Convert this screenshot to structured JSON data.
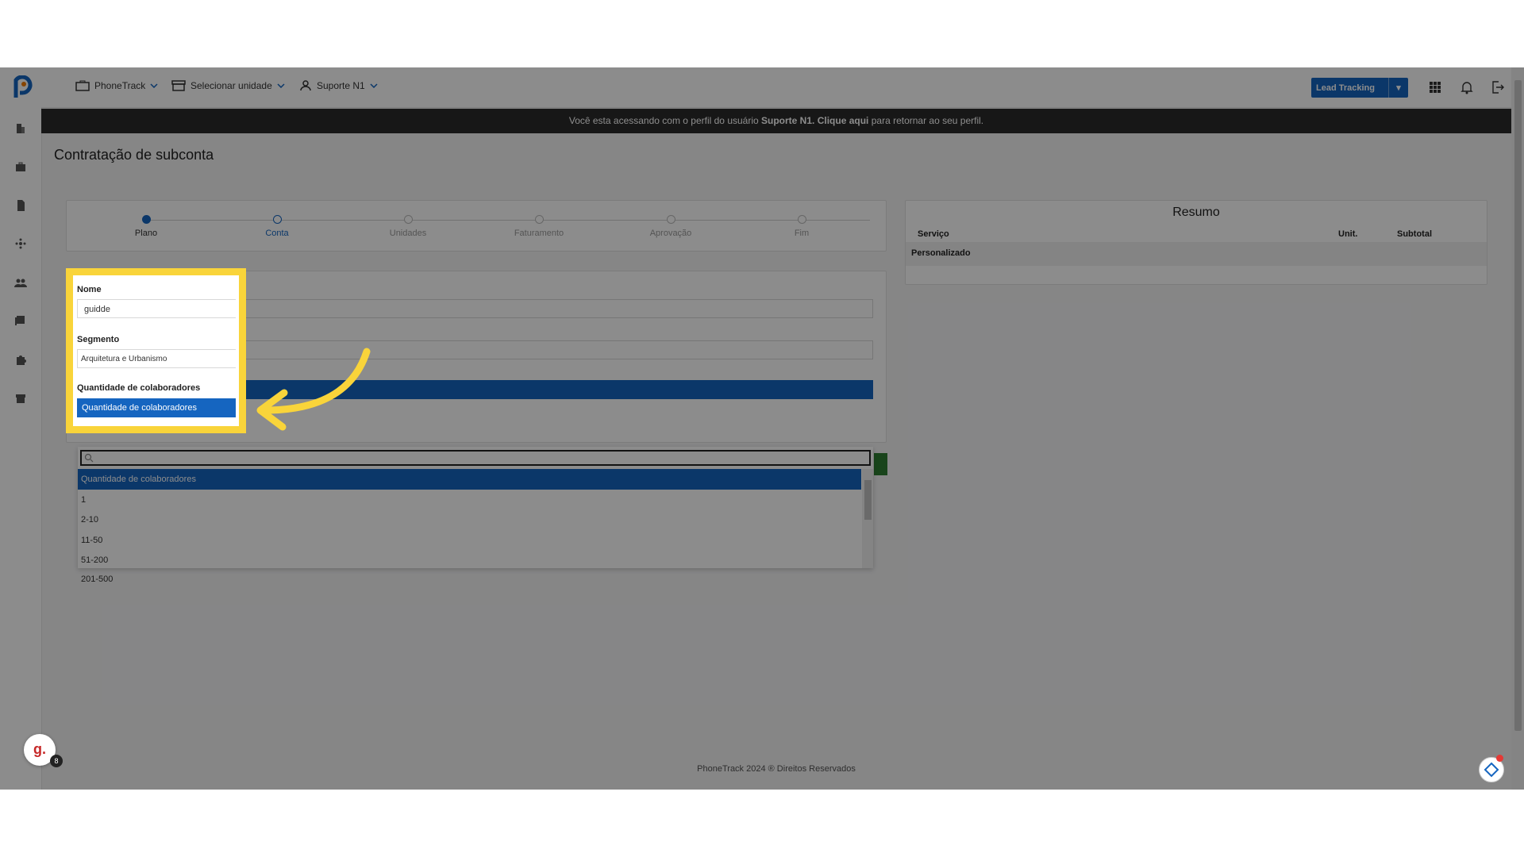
{
  "app": {
    "brand_color": "#1565c0"
  },
  "topbar": {
    "menus": [
      {
        "label": "PhoneTrack",
        "icon": "briefcase-icon"
      },
      {
        "label": "Selecionar unidade",
        "icon": "store-icon"
      },
      {
        "label": "Suporte N1",
        "icon": "user-icon"
      }
    ],
    "lead_tracking": "Lead Tracking"
  },
  "notice": {
    "prefix": "Você esta acessando com o perfil do usuário",
    "user": "Suporte N1.",
    "link": "Clique aqui",
    "suffix": "para retornar ao seu perfil."
  },
  "page": {
    "title": "Contratação de subconta"
  },
  "steps": [
    {
      "label": "Plano",
      "state": "done"
    },
    {
      "label": "Conta",
      "state": "active"
    },
    {
      "label": "Unidades",
      "state": "pending"
    },
    {
      "label": "Faturamento",
      "state": "pending"
    },
    {
      "label": "Aprovação",
      "state": "pending"
    },
    {
      "label": "Fim",
      "state": "pending"
    }
  ],
  "form": {
    "nome_label": "Nome",
    "nome_value": "guidde",
    "segmento_label": "Segmento",
    "segmento_value": "Arquitetura e Urbanismo",
    "qtd_label": "Quantidade de colaboradores",
    "qtd_value": "Quantidade de colaboradores"
  },
  "dropdown": {
    "options": [
      "Quantidade de colaboradores",
      "1",
      "2-10",
      "11-50",
      "51-200",
      "201-500"
    ],
    "selected_index": 0
  },
  "resumo": {
    "title": "Resumo",
    "columns": [
      "Serviço",
      "Unit.",
      "Subtotal"
    ],
    "rows": [
      [
        "Personalizado",
        "",
        ""
      ]
    ]
  },
  "footer": {
    "text": "PhoneTrack 2024 ® Direitos Reservados"
  },
  "guidde": {
    "letter": "g.",
    "badge": "8"
  },
  "colors": {
    "highlight": "#f9d43a",
    "dark_bar": "#2b2b2b"
  }
}
